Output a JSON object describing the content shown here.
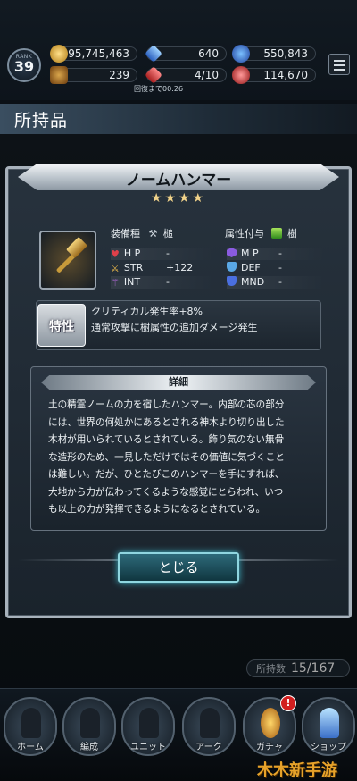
{
  "status": {
    "rank_label": "RANK",
    "rank_value": "39",
    "gold": "95,745,463",
    "chest": "239",
    "gem_blue": "640",
    "gem_blue_2": "4/10",
    "orb_blue": "550,843",
    "orb_red": "114,670",
    "recover_text": "回復まで00:26"
  },
  "page": {
    "title": "所持品"
  },
  "modal": {
    "title": "ノームハンマー",
    "stars": "★★★★",
    "weapon_type_label": "装備種",
    "weapon_type_value": "槌",
    "attribute_label": "属性付与",
    "attribute_value": "樹",
    "stats": [
      {
        "name": "H P",
        "value": "-"
      },
      {
        "name": "STR",
        "value": "+122"
      },
      {
        "name": "INT",
        "value": "-"
      },
      {
        "name": "M P",
        "value": "-"
      },
      {
        "name": "DEF",
        "value": "-"
      },
      {
        "name": "MND",
        "value": "-"
      }
    ],
    "trait_badge": "特性",
    "trait_line1": "クリティカル発生率+8%",
    "trait_line2": "通常攻撃に樹属性の追加ダメージ発生",
    "detail_title": "詳細",
    "detail_text": "土の精霊ノームの力を宿したハンマー。内部の芯の部分\nには、世界の何処かにあるとされる神木より切り出した\n木材が用いられているとされている。飾り気のない無骨\nな造形のため、一見しただけではその価値に気づくこと\nは難しい。だが、ひとたびこのハンマーを手にすれば、\n大地から力が伝わってくるような感覚にとらわれ、いつ\nも以上の力が発揮できるようになるとされている。",
    "close_label": "とじる"
  },
  "inventory": {
    "count_label": "所持数",
    "count_value": "15/167"
  },
  "nav": [
    {
      "label": "ホーム"
    },
    {
      "label": "編成"
    },
    {
      "label": "ユニット"
    },
    {
      "label": "アーク"
    },
    {
      "label": "ガチャ"
    },
    {
      "label": "ショップ"
    }
  ],
  "notif_badge": "!",
  "watermark": "木木新手游",
  "colors": {
    "accent": "#3fb6c8",
    "star": "#f0d28a",
    "hp": "#e0404a",
    "str": "#e6b54a",
    "int": "#b86ae0"
  }
}
